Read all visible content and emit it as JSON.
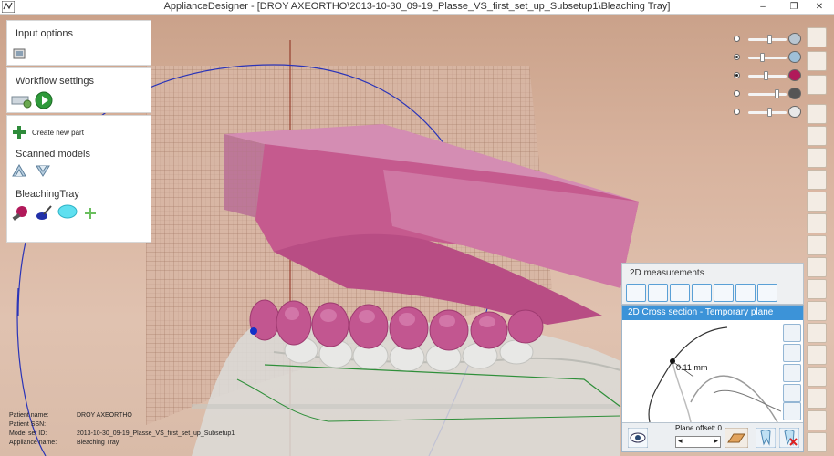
{
  "window": {
    "title": "ApplianceDesigner - [DROY AXEORTHO\\2013-10-30_09-19_Plasse_VS_first_set_up_Subsetup1\\Bleaching Tray]",
    "minimize": "–",
    "maximize": "❐",
    "close": "✕"
  },
  "panels": {
    "input_options": {
      "title": "Input options",
      "icon": "input-options-icon"
    },
    "workflow": {
      "title": "Workflow settings",
      "icons": [
        "workflow-settings-icon",
        "play-icon"
      ]
    },
    "parts": {
      "create_new_part": "Create new part",
      "scanned_models_title": "Scanned models",
      "scanned_icons": [
        "upper-jaw-scan-icon",
        "lower-jaw-scan-icon"
      ],
      "bleaching_tray_title": "BleachingTray",
      "tray_icons": [
        "sculpt-tool-icon",
        "brush-tool-icon",
        "tray-shape-icon",
        "add-icon"
      ]
    }
  },
  "patient_info": [
    {
      "label": "Patient name:",
      "value": "DROY AXEORTHO"
    },
    {
      "label": "Patient SSN:",
      "value": ""
    },
    {
      "label": "Model set ID:",
      "value": "2013-10-30_09-19_Plasse_VS_first_set_up_Subsetup1"
    },
    {
      "label": "Appliance name:",
      "value": "Bleaching Tray"
    }
  ],
  "visibility_sliders": [
    {
      "name": "upper-model-visibility",
      "selected": false,
      "level": 0.55,
      "icon": "upper-model-icon"
    },
    {
      "name": "lower-model-visibility",
      "selected": true,
      "level": 0.35,
      "icon": "lower-model-icon"
    },
    {
      "name": "sculpt-visibility",
      "selected": true,
      "level": 0.45,
      "icon": "sculpt-icon"
    },
    {
      "name": "brush-visibility",
      "selected": false,
      "level": 0.75,
      "icon": "brush-icon"
    },
    {
      "name": "tray-visibility",
      "selected": false,
      "level": 0.55,
      "icon": "tray-icon"
    }
  ],
  "measurements": {
    "title": "2D measurements",
    "tools": [
      "point-distance-icon",
      "multi-point-distance-icon",
      "line-distance-icon",
      "curve-distance-icon",
      "vertical-distance-icon",
      "parallel-distance-icon",
      "angle-distance-icon"
    ]
  },
  "cross_section": {
    "title": "2D Cross section - Temporary plane",
    "distance_label": "0.11 mm",
    "plane_offset_label": "Plane offset: 0",
    "side_tools": [
      "cross-section-1-icon",
      "cross-section-2-icon",
      "layer-icon",
      "delete-section-icon",
      "measure-probe-icon"
    ],
    "bottom_tools": [
      "eye-icon",
      "offset-stepper",
      "plane-icon",
      "tooth-view-icon",
      "close-section-icon"
    ]
  },
  "colors": {
    "tray": "#c55a8e",
    "grid": "#9a6e5a",
    "accent": "#3c93d8",
    "arc": "#2a34b8"
  }
}
